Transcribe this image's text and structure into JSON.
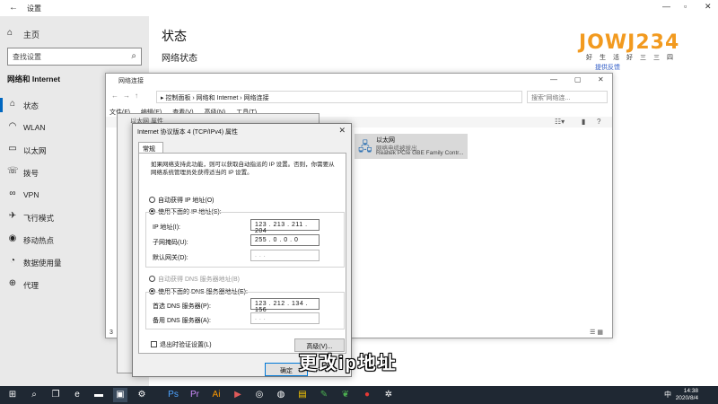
{
  "settings": {
    "title": "设置",
    "home": "主页",
    "search_placeholder": "查找设置",
    "category": "网络和 Internet",
    "nav": [
      {
        "label": "状态",
        "icon": "home-network-icon"
      },
      {
        "label": "WLAN",
        "icon": "wifi-icon"
      },
      {
        "label": "以太网",
        "icon": "ethernet-icon"
      },
      {
        "label": "拨号",
        "icon": "dialup-icon"
      },
      {
        "label": "VPN",
        "icon": "vpn-icon"
      },
      {
        "label": "飞行模式",
        "icon": "airplane-icon"
      },
      {
        "label": "移动热点",
        "icon": "hotspot-icon"
      },
      {
        "label": "数据使用量",
        "icon": "data-usage-icon"
      },
      {
        "label": "代理",
        "icon": "globe-icon"
      }
    ],
    "main_title": "状态",
    "main_subtitle": "网络状态"
  },
  "logo": {
    "text": "JOWJ234",
    "tagline": "好生活好三三四",
    "feedback": "提供反馈"
  },
  "netconn": {
    "title": "网络连接",
    "breadcrumb": "▸ 控制面板 › 网络和 Internet › 网络连接",
    "search": "搜索\"网络连...",
    "menu": [
      "文件(F)",
      "编辑(E)",
      "查看(V)",
      "高级(N)",
      "工具(T)"
    ],
    "adapter": {
      "name": "以太网",
      "status": "网络电缆被拔出",
      "device": "Realtek PCIe GBE Family Contr..."
    },
    "status_count": "3"
  },
  "ethprops": {
    "title": "以太网 属性"
  },
  "ipv4": {
    "title": "Internet 协议版本 4 (TCP/IPv4) 属性",
    "tab": "常规",
    "description": "如果网络支持此功能，则可以获取自动指派的 IP 设置。否则，你需要从网络系统管理员处获得适当的 IP 设置。",
    "auto_ip": "自动获得 IP 地址(O)",
    "manual_ip": "使用下面的 IP 地址(S):",
    "ip_label": "IP 地址(I):",
    "ip_value": "123 . 213 . 211 . 204",
    "mask_label": "子网掩码(U):",
    "mask_value": "255 . 0 . 0 . 0",
    "gateway_label": "默认网关(D):",
    "gateway_value": ".   .   .",
    "auto_dns": "自动获得 DNS 服务器地址(B)",
    "manual_dns": "使用下面的 DNS 服务器地址(E):",
    "pref_dns_label": "首选 DNS 服务器(P):",
    "pref_dns_value": "123 . 212 . 134 . 156",
    "alt_dns_label": "备用 DNS 服务器(A):",
    "alt_dns_value": ".   .   .",
    "validate": "退出时验证设置(L)",
    "advanced": "高级(V)...",
    "ok": "确定"
  },
  "subtitle": "更改ip地址",
  "taskbar": {
    "time": "14:38",
    "date": "2020/8/4",
    "ime": "中"
  }
}
